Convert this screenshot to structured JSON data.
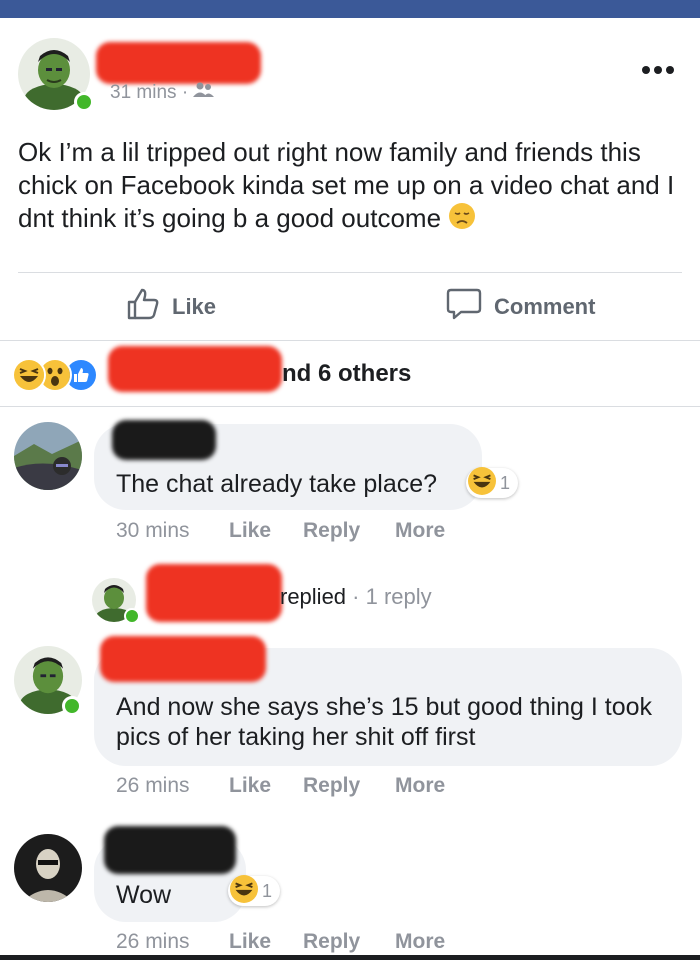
{
  "post": {
    "author_name": "",
    "time": "31 mins",
    "separator": "·",
    "privacy_icon": "friends-icon",
    "text": "Ok I’m a lil tripped out right now family and friends this chick on Facebook kinda set me up on a video chat and I dnt think it’s going b a good outcome",
    "text_emoji": "disappointed-face-emoji"
  },
  "actions": {
    "like_label": "Like",
    "comment_label": "Comment"
  },
  "reactions": {
    "icons": [
      "haha-reaction",
      "wow-reaction",
      "like-reaction"
    ],
    "summary_suffix": "nd 6 others"
  },
  "comments": [
    {
      "author_name": "",
      "text": "The chat already take place?",
      "reaction_count": "1",
      "time": "30 mins",
      "like": "Like",
      "reply": "Reply",
      "more": "More"
    },
    {
      "author_name": "",
      "text": "And now she says she’s 15 but good thing I took pics of her taking her shit off first",
      "time": "26 mins",
      "like": "Like",
      "reply": "Reply",
      "more": "More"
    },
    {
      "author_name": "",
      "text": "Wow",
      "reaction_count": "1",
      "time": "26 mins",
      "like": "Like",
      "reply": "Reply",
      "more": "More"
    }
  ],
  "reply_summary": {
    "replied": "replied",
    "separator": "·",
    "count": "1 reply"
  },
  "colors": {
    "topbar": "#3b5998",
    "online": "#42b72a",
    "bubble": "#f0f2f5",
    "muted": "#90949c"
  }
}
